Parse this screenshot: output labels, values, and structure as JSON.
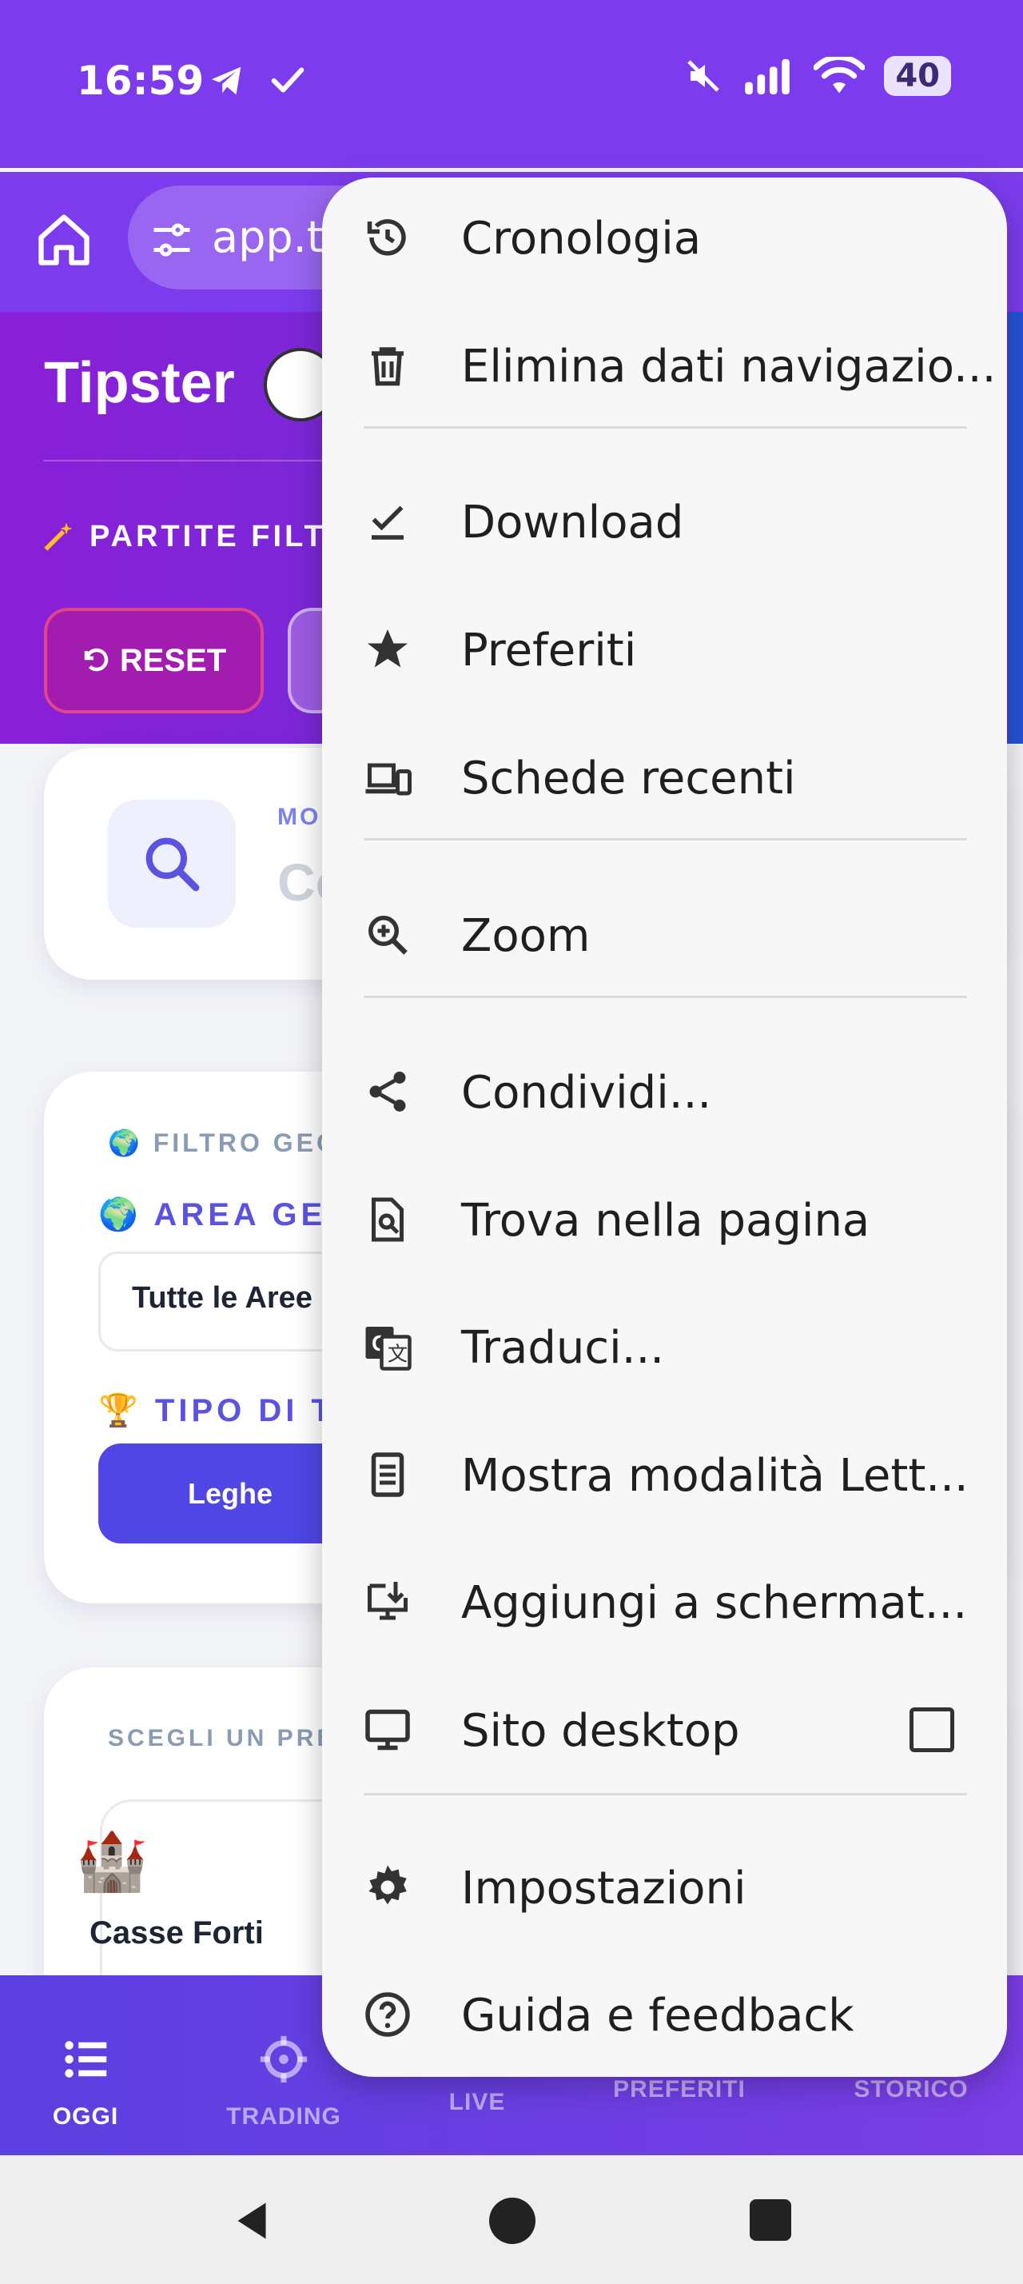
{
  "status_bar": {
    "time": "16:59",
    "battery": "40"
  },
  "browser": {
    "url": "app.t"
  },
  "hero": {
    "title": "Tipster",
    "subtitle": "PARTITE FILT",
    "reset_label": "RESET"
  },
  "search_card": {
    "mode_label": "MO",
    "input_text": "Co"
  },
  "geo_card": {
    "filter_label": "🌍 FILTRO GEO",
    "area_label": "🌍 AREA GEO",
    "area_value": "Tutte le Aree",
    "type_label": "🏆 TIPO DI TO",
    "leagues_button": "Leghe"
  },
  "pick_card": {
    "label": "SCEGLI UN PRE",
    "item_icon": "🏰",
    "item_name": "Casse Forti"
  },
  "bottom_nav": {
    "items": [
      {
        "label": "OGGI",
        "icon": "list-icon",
        "active": true
      },
      {
        "label": "TRADING",
        "icon": "target-icon",
        "active": false
      },
      {
        "label": "LIVE",
        "icon": "live-icon",
        "active": false
      },
      {
        "label": "PREFERITI",
        "icon": "star-icon",
        "active": false
      },
      {
        "label": "STORICO",
        "icon": "history-icon",
        "active": false
      }
    ]
  },
  "menu": {
    "items": [
      {
        "label": "Cronologia",
        "icon": "history-icon"
      },
      {
        "label": "Elimina dati navigazio...",
        "icon": "trash-icon"
      },
      {
        "label": "Download",
        "icon": "download-check-icon"
      },
      {
        "label": "Preferiti",
        "icon": "star-icon"
      },
      {
        "label": "Schede recenti",
        "icon": "devices-icon"
      },
      {
        "label": "Zoom",
        "icon": "zoom-icon"
      },
      {
        "label": "Condividi...",
        "icon": "share-icon"
      },
      {
        "label": "Trova nella pagina",
        "icon": "find-in-page-icon"
      },
      {
        "label": "Traduci...",
        "icon": "translate-icon"
      },
      {
        "label": "Mostra modalità Lett...",
        "icon": "reader-mode-icon"
      },
      {
        "label": "Aggiungi a schermat...",
        "icon": "add-to-home-icon"
      },
      {
        "label": "Sito desktop",
        "icon": "desktop-icon",
        "checked": false
      },
      {
        "label": "Impostazioni",
        "icon": "gear-icon"
      },
      {
        "label": "Guida e feedback",
        "icon": "help-icon"
      }
    ]
  },
  "colors": {
    "primary": "#7c3ced",
    "accent": "#4f46e5",
    "menu_bg": "#f7f7f7"
  }
}
